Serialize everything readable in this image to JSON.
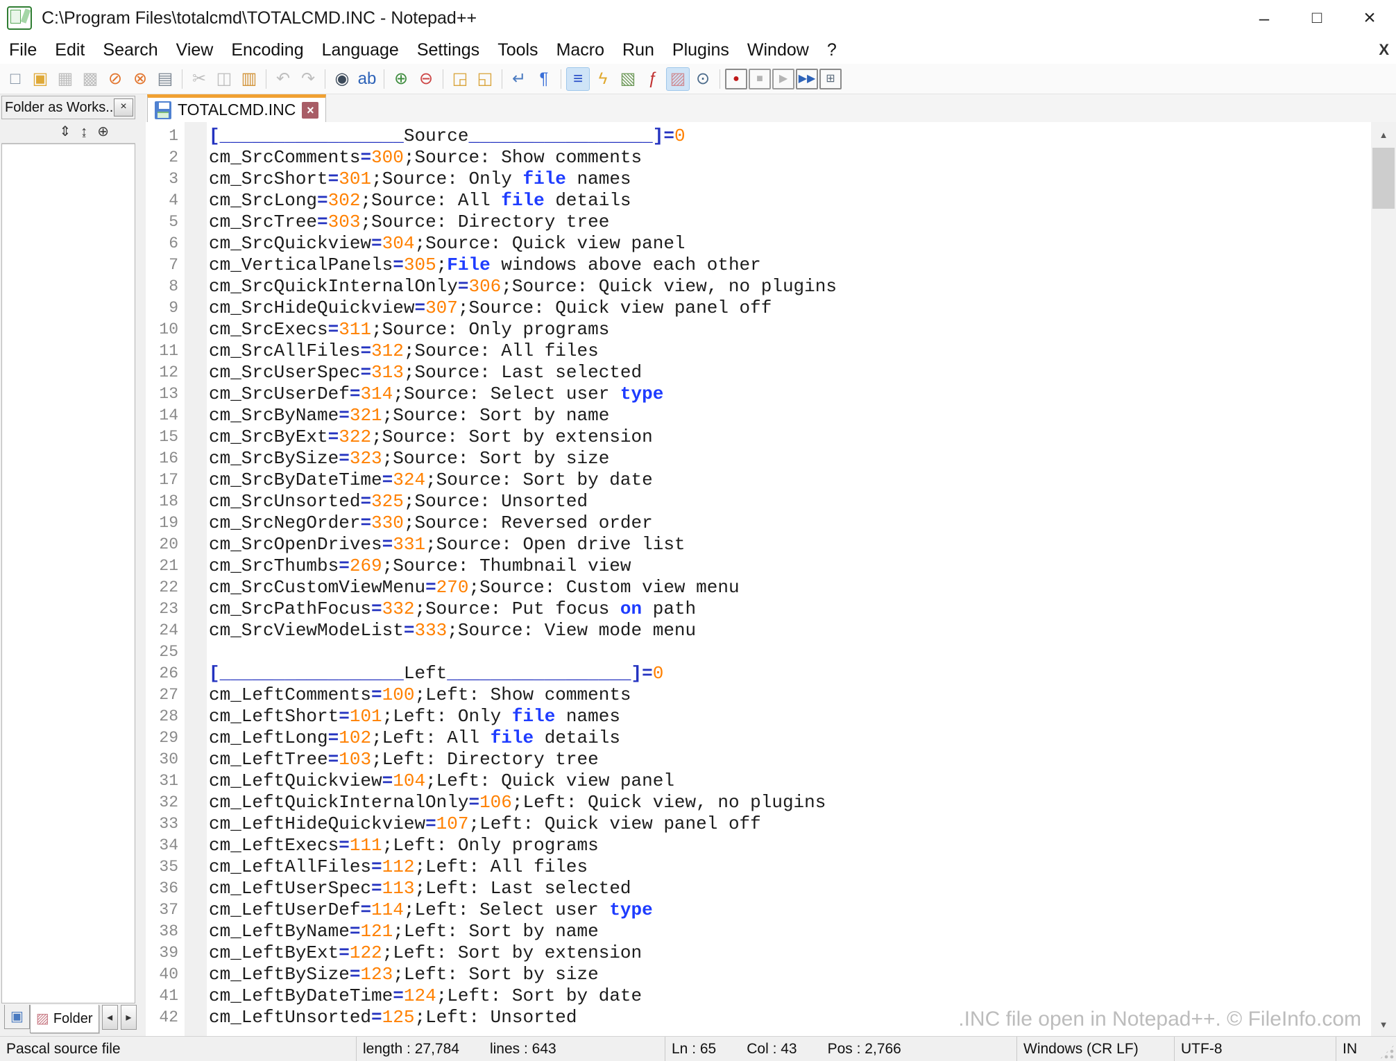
{
  "colors": {
    "accent": "#f0a132",
    "operator": "#2433c0",
    "number": "#ff8000",
    "keyword": "#1e3cff",
    "deftext": "#1c1c1c"
  },
  "window": {
    "title": "C:\\Program Files\\totalcmd\\TOTALCMD.INC - Notepad++"
  },
  "glyphs": {
    "minimize": "–",
    "maximize": "□",
    "close": "×",
    "menu_close": "X",
    "panel_close": "×",
    "tab_close": "×",
    "scroll_up": "▲",
    "scroll_down": "▼",
    "tab_left": "◂",
    "tab_right": "▸"
  },
  "menu": {
    "items": [
      "File",
      "Edit",
      "Search",
      "View",
      "Encoding",
      "Language",
      "Settings",
      "Tools",
      "Macro",
      "Run",
      "Plugins",
      "Window",
      "?"
    ]
  },
  "toolbar": {
    "items": [
      {
        "name": "new-file-button",
        "glyph": "□",
        "color": "#7d8da0"
      },
      {
        "name": "open-file-button",
        "glyph": "▣",
        "color": "#dfa938"
      },
      {
        "name": "save-button",
        "glyph": "▦",
        "color": "#b4b4b4",
        "disabled": true
      },
      {
        "name": "save-all-button",
        "glyph": "▩",
        "color": "#b4b4b4",
        "disabled": true
      },
      {
        "name": "close-button",
        "glyph": "⊘",
        "color": "#e2752e"
      },
      {
        "name": "close-all-button",
        "glyph": "⊗",
        "color": "#e2752e"
      },
      {
        "name": "print-button",
        "glyph": "▤",
        "color": "#7d8894"
      },
      {
        "name": "cut-button",
        "glyph": "✂",
        "color": "#b4b4b4",
        "disabled": true,
        "sep": true
      },
      {
        "name": "copy-button",
        "glyph": "◫",
        "color": "#b4b4b4",
        "disabled": true
      },
      {
        "name": "paste-button",
        "glyph": "▥",
        "color": "#d2943a"
      },
      {
        "name": "undo-button",
        "glyph": "↶",
        "color": "#b4b4b4",
        "disabled": true,
        "sep": true
      },
      {
        "name": "redo-button",
        "glyph": "↷",
        "color": "#b4b4b4",
        "disabled": true
      },
      {
        "name": "find-button",
        "glyph": "◉",
        "color": "#3c4a5a",
        "sep": true
      },
      {
        "name": "replace-button",
        "glyph": "ab",
        "color": "#2e63b8"
      },
      {
        "name": "zoom-in-button",
        "glyph": "⊕",
        "color": "#3f8d3f",
        "sep": true
      },
      {
        "name": "zoom-out-button",
        "glyph": "⊖",
        "color": "#cc4444"
      },
      {
        "name": "sync-vertical-scroll-button",
        "glyph": "◲",
        "color": "#d9a43a",
        "sep": true
      },
      {
        "name": "sync-horizontal-scroll-button",
        "glyph": "◱",
        "color": "#d9a43a"
      },
      {
        "name": "word-wrap-button",
        "glyph": "↵",
        "color": "#4a7ac0",
        "sep": true
      },
      {
        "name": "show-all-characters-button",
        "glyph": "¶",
        "color": "#3a6fd8"
      },
      {
        "name": "show-indent-guide-button",
        "glyph": "≡",
        "color": "#2b50c8",
        "pressed": true,
        "sep": true
      },
      {
        "name": "define-language-button",
        "glyph": "ϟ",
        "color": "#e0a92e"
      },
      {
        "name": "document-map-button",
        "glyph": "▧",
        "color": "#6f9a5a"
      },
      {
        "name": "function-list-button",
        "glyph": "ƒ",
        "color": "#c03030"
      },
      {
        "name": "folder-as-workspace-button",
        "glyph": "▨",
        "color": "#cf8d95",
        "pressed": true
      },
      {
        "name": "monitoring-button",
        "glyph": "⊙",
        "color": "#4a6a8a"
      },
      {
        "name": "macro-record-button",
        "glyph": "●",
        "color": "#bf1818",
        "framed": true,
        "sep": true
      },
      {
        "name": "macro-stop-button",
        "glyph": "■",
        "color": "#a8a8a8",
        "framed": true,
        "disabled": true
      },
      {
        "name": "macro-play-button",
        "glyph": "▶",
        "color": "#a8a8a8",
        "framed": true,
        "disabled": true
      },
      {
        "name": "macro-run-multiple-button",
        "glyph": "▶▶",
        "color": "#2e63b8",
        "framed": true
      },
      {
        "name": "macro-save-button",
        "glyph": "⊞",
        "color": "#5a6a7a",
        "framed": true
      }
    ]
  },
  "panel": {
    "title": "Folder as Works..",
    "tools": [
      {
        "name": "expand-all-button",
        "glyph": "⇕"
      },
      {
        "name": "collapse-all-button",
        "glyph": "↨"
      },
      {
        "name": "locate-current-file-button",
        "glyph": "⊕"
      }
    ],
    "bottom": {
      "workspace_glyph": "▣",
      "folder_glyph": "▨",
      "folder_label": "Folder"
    }
  },
  "tab": {
    "label": "TOTALCMD.INC"
  },
  "watermark": ".INC file open in Notepad++. © FileInfo.com",
  "status": {
    "doc_type": "Pascal source file",
    "length": "length : 27,784",
    "lines": "lines : 643",
    "ln": "Ln : 65",
    "col": "Col : 43",
    "pos": "Pos : 2,766",
    "eol": "Windows (CR LF)",
    "encoding": "UTF-8",
    "typing_mode": "IN"
  },
  "editor": {
    "first_line": 1,
    "lines": [
      [
        [
          "o",
          "[_________________"
        ],
        [
          "d",
          "Source"
        ],
        [
          "o",
          "_________________]="
        ],
        [
          "n",
          "0"
        ]
      ],
      [
        [
          "d",
          "cm_SrcComments"
        ],
        [
          "o",
          "="
        ],
        [
          "n",
          "300"
        ],
        [
          "d",
          ";Source: Show comments"
        ]
      ],
      [
        [
          "d",
          "cm_SrcShort"
        ],
        [
          "o",
          "="
        ],
        [
          "n",
          "301"
        ],
        [
          "d",
          ";Source: Only "
        ],
        [
          "k",
          "file"
        ],
        [
          "d",
          " names"
        ]
      ],
      [
        [
          "d",
          "cm_SrcLong"
        ],
        [
          "o",
          "="
        ],
        [
          "n",
          "302"
        ],
        [
          "d",
          ";Source: All "
        ],
        [
          "k",
          "file"
        ],
        [
          "d",
          " details"
        ]
      ],
      [
        [
          "d",
          "cm_SrcTree"
        ],
        [
          "o",
          "="
        ],
        [
          "n",
          "303"
        ],
        [
          "d",
          ";Source: Directory tree"
        ]
      ],
      [
        [
          "d",
          "cm_SrcQuickview"
        ],
        [
          "o",
          "="
        ],
        [
          "n",
          "304"
        ],
        [
          "d",
          ";Source: Quick view panel"
        ]
      ],
      [
        [
          "d",
          "cm_VerticalPanels"
        ],
        [
          "o",
          "="
        ],
        [
          "n",
          "305"
        ],
        [
          "d",
          ";"
        ],
        [
          "k",
          "File"
        ],
        [
          "d",
          " windows above each other"
        ]
      ],
      [
        [
          "d",
          "cm_SrcQuickInternalOnly"
        ],
        [
          "o",
          "="
        ],
        [
          "n",
          "306"
        ],
        [
          "d",
          ";Source: Quick view, no plugins"
        ]
      ],
      [
        [
          "d",
          "cm_SrcHideQuickview"
        ],
        [
          "o",
          "="
        ],
        [
          "n",
          "307"
        ],
        [
          "d",
          ";Source: Quick view panel off"
        ]
      ],
      [
        [
          "d",
          "cm_SrcExecs"
        ],
        [
          "o",
          "="
        ],
        [
          "n",
          "311"
        ],
        [
          "d",
          ";Source: Only programs"
        ]
      ],
      [
        [
          "d",
          "cm_SrcAllFiles"
        ],
        [
          "o",
          "="
        ],
        [
          "n",
          "312"
        ],
        [
          "d",
          ";Source: All files"
        ]
      ],
      [
        [
          "d",
          "cm_SrcUserSpec"
        ],
        [
          "o",
          "="
        ],
        [
          "n",
          "313"
        ],
        [
          "d",
          ";Source: Last selected"
        ]
      ],
      [
        [
          "d",
          "cm_SrcUserDef"
        ],
        [
          "o",
          "="
        ],
        [
          "n",
          "314"
        ],
        [
          "d",
          ";Source: Select user "
        ],
        [
          "k",
          "type"
        ]
      ],
      [
        [
          "d",
          "cm_SrcByName"
        ],
        [
          "o",
          "="
        ],
        [
          "n",
          "321"
        ],
        [
          "d",
          ";Source: Sort by name"
        ]
      ],
      [
        [
          "d",
          "cm_SrcByExt"
        ],
        [
          "o",
          "="
        ],
        [
          "n",
          "322"
        ],
        [
          "d",
          ";Source: Sort by extension"
        ]
      ],
      [
        [
          "d",
          "cm_SrcBySize"
        ],
        [
          "o",
          "="
        ],
        [
          "n",
          "323"
        ],
        [
          "d",
          ";Source: Sort by size"
        ]
      ],
      [
        [
          "d",
          "cm_SrcByDateTime"
        ],
        [
          "o",
          "="
        ],
        [
          "n",
          "324"
        ],
        [
          "d",
          ";Source: Sort by date"
        ]
      ],
      [
        [
          "d",
          "cm_SrcUnsorted"
        ],
        [
          "o",
          "="
        ],
        [
          "n",
          "325"
        ],
        [
          "d",
          ";Source: Unsorted"
        ]
      ],
      [
        [
          "d",
          "cm_SrcNegOrder"
        ],
        [
          "o",
          "="
        ],
        [
          "n",
          "330"
        ],
        [
          "d",
          ";Source: Reversed order"
        ]
      ],
      [
        [
          "d",
          "cm_SrcOpenDrives"
        ],
        [
          "o",
          "="
        ],
        [
          "n",
          "331"
        ],
        [
          "d",
          ";Source: Open drive list"
        ]
      ],
      [
        [
          "d",
          "cm_SrcThumbs"
        ],
        [
          "o",
          "="
        ],
        [
          "n",
          "269"
        ],
        [
          "d",
          ";Source: Thumbnail view"
        ]
      ],
      [
        [
          "d",
          "cm_SrcCustomViewMenu"
        ],
        [
          "o",
          "="
        ],
        [
          "n",
          "270"
        ],
        [
          "d",
          ";Source: Custom view menu"
        ]
      ],
      [
        [
          "d",
          "cm_SrcPathFocus"
        ],
        [
          "o",
          "="
        ],
        [
          "n",
          "332"
        ],
        [
          "d",
          ";Source: Put focus "
        ],
        [
          "k",
          "on"
        ],
        [
          "d",
          " path"
        ]
      ],
      [
        [
          "d",
          "cm_SrcViewModeList"
        ],
        [
          "o",
          "="
        ],
        [
          "n",
          "333"
        ],
        [
          "d",
          ";Source: View mode menu"
        ]
      ],
      [],
      [
        [
          "o",
          "[_________________"
        ],
        [
          "d",
          "Left"
        ],
        [
          "o",
          "_________________]="
        ],
        [
          "n",
          "0"
        ]
      ],
      [
        [
          "d",
          "cm_LeftComments"
        ],
        [
          "o",
          "="
        ],
        [
          "n",
          "100"
        ],
        [
          "d",
          ";Left: Show comments"
        ]
      ],
      [
        [
          "d",
          "cm_LeftShort"
        ],
        [
          "o",
          "="
        ],
        [
          "n",
          "101"
        ],
        [
          "d",
          ";Left: Only "
        ],
        [
          "k",
          "file"
        ],
        [
          "d",
          " names"
        ]
      ],
      [
        [
          "d",
          "cm_LeftLong"
        ],
        [
          "o",
          "="
        ],
        [
          "n",
          "102"
        ],
        [
          "d",
          ";Left: All "
        ],
        [
          "k",
          "file"
        ],
        [
          "d",
          " details"
        ]
      ],
      [
        [
          "d",
          "cm_LeftTree"
        ],
        [
          "o",
          "="
        ],
        [
          "n",
          "103"
        ],
        [
          "d",
          ";Left: Directory tree"
        ]
      ],
      [
        [
          "d",
          "cm_LeftQuickview"
        ],
        [
          "o",
          "="
        ],
        [
          "n",
          "104"
        ],
        [
          "d",
          ";Left: Quick view panel"
        ]
      ],
      [
        [
          "d",
          "cm_LeftQuickInternalOnly"
        ],
        [
          "o",
          "="
        ],
        [
          "n",
          "106"
        ],
        [
          "d",
          ";Left: Quick view, no plugins"
        ]
      ],
      [
        [
          "d",
          "cm_LeftHideQuickview"
        ],
        [
          "o",
          "="
        ],
        [
          "n",
          "107"
        ],
        [
          "d",
          ";Left: Quick view panel off"
        ]
      ],
      [
        [
          "d",
          "cm_LeftExecs"
        ],
        [
          "o",
          "="
        ],
        [
          "n",
          "111"
        ],
        [
          "d",
          ";Left: Only programs"
        ]
      ],
      [
        [
          "d",
          "cm_LeftAllFiles"
        ],
        [
          "o",
          "="
        ],
        [
          "n",
          "112"
        ],
        [
          "d",
          ";Left: All files"
        ]
      ],
      [
        [
          "d",
          "cm_LeftUserSpec"
        ],
        [
          "o",
          "="
        ],
        [
          "n",
          "113"
        ],
        [
          "d",
          ";Left: Last selected"
        ]
      ],
      [
        [
          "d",
          "cm_LeftUserDef"
        ],
        [
          "o",
          "="
        ],
        [
          "n",
          "114"
        ],
        [
          "d",
          ";Left: Select user "
        ],
        [
          "k",
          "type"
        ]
      ],
      [
        [
          "d",
          "cm_LeftByName"
        ],
        [
          "o",
          "="
        ],
        [
          "n",
          "121"
        ],
        [
          "d",
          ";Left: Sort by name"
        ]
      ],
      [
        [
          "d",
          "cm_LeftByExt"
        ],
        [
          "o",
          "="
        ],
        [
          "n",
          "122"
        ],
        [
          "d",
          ";Left: Sort by extension"
        ]
      ],
      [
        [
          "d",
          "cm_LeftBySize"
        ],
        [
          "o",
          "="
        ],
        [
          "n",
          "123"
        ],
        [
          "d",
          ";Left: Sort by size"
        ]
      ],
      [
        [
          "d",
          "cm_LeftByDateTime"
        ],
        [
          "o",
          "="
        ],
        [
          "n",
          "124"
        ],
        [
          "d",
          ";Left: Sort by date"
        ]
      ],
      [
        [
          "d",
          "cm_LeftUnsorted"
        ],
        [
          "o",
          "="
        ],
        [
          "n",
          "125"
        ],
        [
          "d",
          ";Left: Unsorted"
        ]
      ]
    ]
  }
}
